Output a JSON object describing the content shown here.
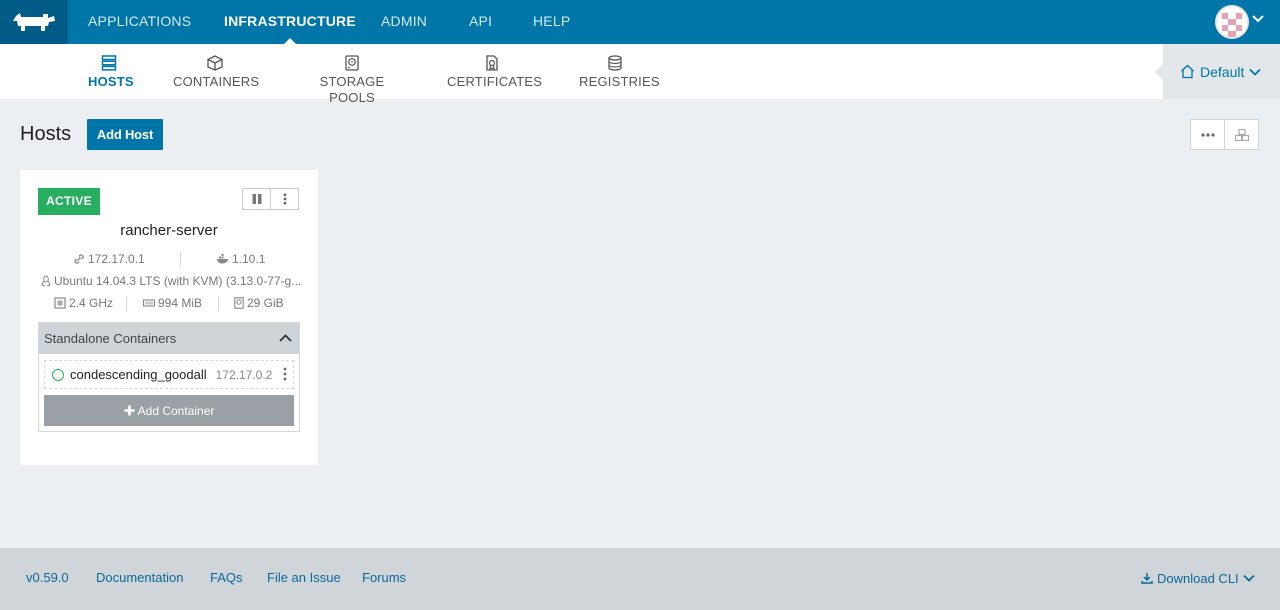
{
  "topnav": {
    "items": [
      {
        "label": "APPLICATIONS"
      },
      {
        "label": "INFRASTRUCTURE",
        "active": true
      },
      {
        "label": "ADMIN"
      },
      {
        "label": "API"
      },
      {
        "label": "HELP"
      }
    ]
  },
  "subnav": {
    "items": [
      {
        "label": "HOSTS",
        "icon": "hosts-icon",
        "active": true
      },
      {
        "label": "CONTAINERS",
        "icon": "box-icon"
      },
      {
        "label": "STORAGE POOLS",
        "icon": "disk-icon"
      },
      {
        "label": "CERTIFICATES",
        "icon": "certificate-icon"
      },
      {
        "label": "REGISTRIES",
        "icon": "database-icon"
      }
    ],
    "environment": "Default"
  },
  "page": {
    "title": "Hosts",
    "add_host_label": "Add Host"
  },
  "host": {
    "state": "ACTIVE",
    "name": "rancher-server",
    "ip": "172.17.0.1",
    "docker_version": "1.10.1",
    "os": "Ubuntu 14.04.3 LTS (with KVM) (3.13.0-77-g...",
    "cpu": "2.4 GHz",
    "memory": "994 MiB",
    "storage": "29 GiB",
    "containers_heading": "Standalone Containers",
    "containers": [
      {
        "name": "condescending_goodall",
        "ip": "172.17.0.2",
        "status": "running"
      }
    ],
    "add_container_label": "Add Container"
  },
  "footer": {
    "version": "v0.59.0",
    "links": [
      "Documentation",
      "FAQs",
      "File an Issue",
      "Forums"
    ],
    "download_cli": "Download CLI"
  },
  "colors": {
    "primary": "#0075a8",
    "primary_dark": "#005c86",
    "success": "#27ae60",
    "page_bg": "#eceff1"
  }
}
